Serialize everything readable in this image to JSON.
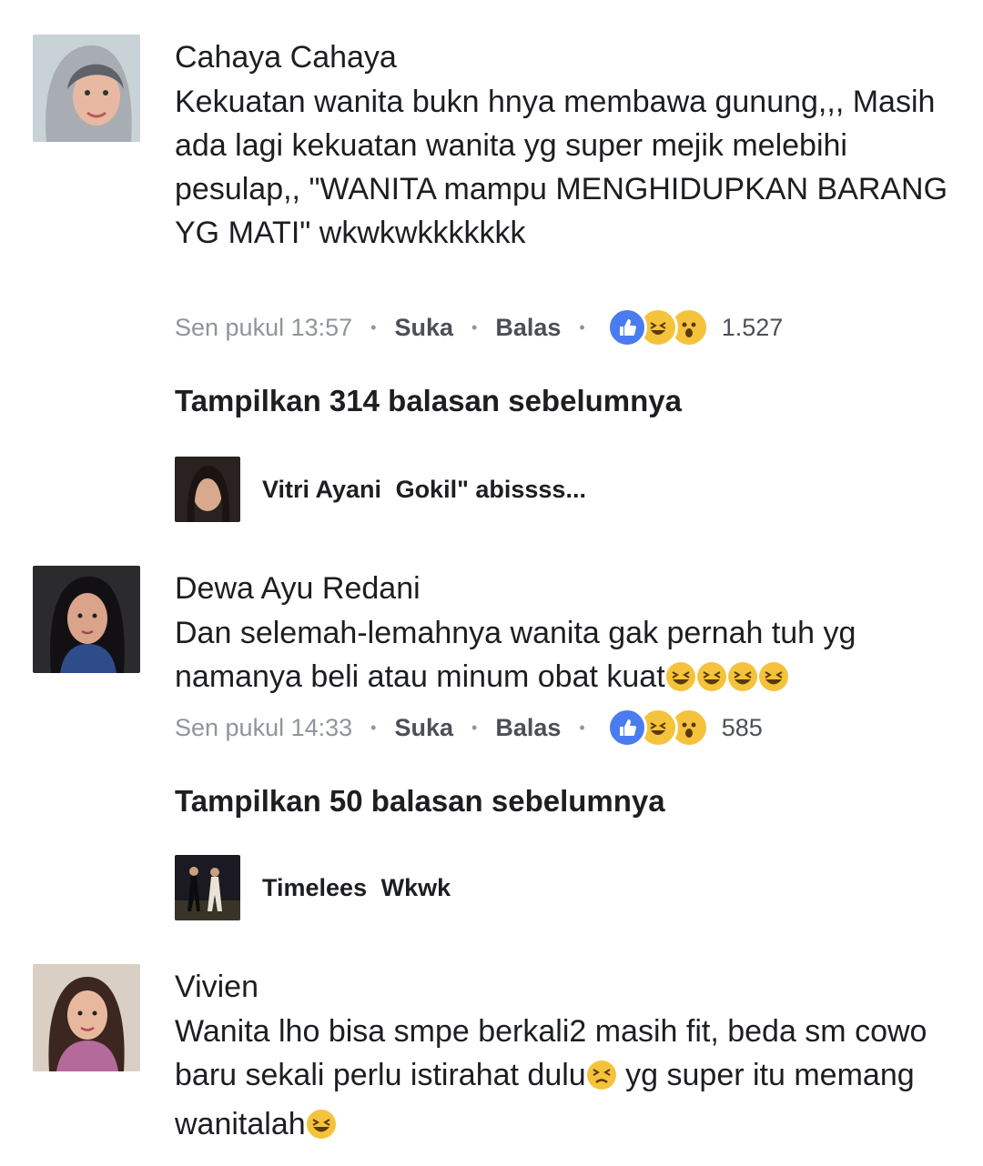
{
  "comments": [
    {
      "name": "Cahaya Cahaya",
      "text": "Kekuatan wanita bukn hnya membawa gunung,,, Masih ada lagi kekuatan wanita yg super mejik melebihi pesulap,, \"WANITA mampu MENGHIDUPKAN BARANG YG MATI\" wkwkwkkkkkkk",
      "time": "Sen pukul 13:57",
      "like_label": "Suka",
      "reply_label": "Balas",
      "reaction_count": "1.527",
      "reaction_icons": [
        "like-icon",
        "haha-icon",
        "wow-icon"
      ],
      "show_more": "Tampilkan 314 balasan sebelumnya",
      "reply_preview": {
        "name": "Vitri Ayani",
        "text": "Gokil\" abissss..."
      }
    },
    {
      "name": "Dewa Ayu Redani",
      "text": "Dan selemah-lemahnya wanita gak pernah tuh yg namanya beli atau minum obat kuat",
      "text_emojis": [
        "laughing-emoji",
        "laughing-emoji",
        "laughing-emoji",
        "laughing-emoji"
      ],
      "time": "Sen pukul 14:33",
      "like_label": "Suka",
      "reply_label": "Balas",
      "reaction_count": "585",
      "reaction_icons": [
        "like-icon",
        "haha-icon",
        "wow-icon"
      ],
      "show_more": "Tampilkan 50 balasan sebelumnya",
      "reply_preview": {
        "name": "Timelees",
        "text": "Wkwk"
      }
    },
    {
      "name": "Vivien",
      "text_part1": "Wanita lho bisa smpe berkali2 masih fit, beda sm cowo baru sekali perlu istirahat dulu",
      "text_part2": " yg super itu memang wanitalah",
      "text_emojis": [
        "tired-emoji",
        "laughing-emoji"
      ]
    }
  ],
  "colors": {
    "like_blue": "#4a7cf0",
    "emoji_yellow": "#f5c33b",
    "meta_grey": "#90949c",
    "action_grey": "#4b4f56"
  }
}
